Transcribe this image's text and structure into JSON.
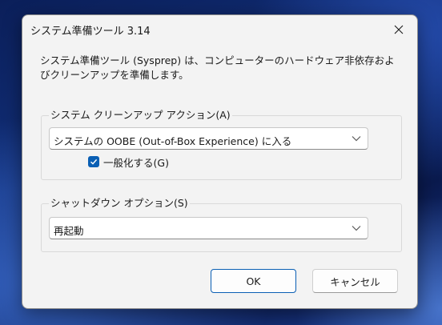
{
  "window": {
    "title": "システム準備ツール 3.14"
  },
  "description": "システム準備ツール (Sysprep) は、コンピューターのハードウェア非依存およびクリーンアップを準備します。",
  "cleanup_group": {
    "label": "システム クリーンアップ アクション(A)",
    "selected": "システムの OOBE (Out-of-Box Experience) に入る",
    "generalize": {
      "label": "一般化する(G)",
      "checked": true
    }
  },
  "shutdown_group": {
    "label": "シャットダウン オプション(S)",
    "selected": "再起動"
  },
  "buttons": {
    "ok": "OK",
    "cancel": "キャンセル"
  },
  "colors": {
    "accent": "#0a5fb4",
    "dialog_bg": "#f3f3f3"
  },
  "icons": {
    "close": "close-icon",
    "dropdown": "chevron-down-icon",
    "check": "checkmark-icon"
  }
}
